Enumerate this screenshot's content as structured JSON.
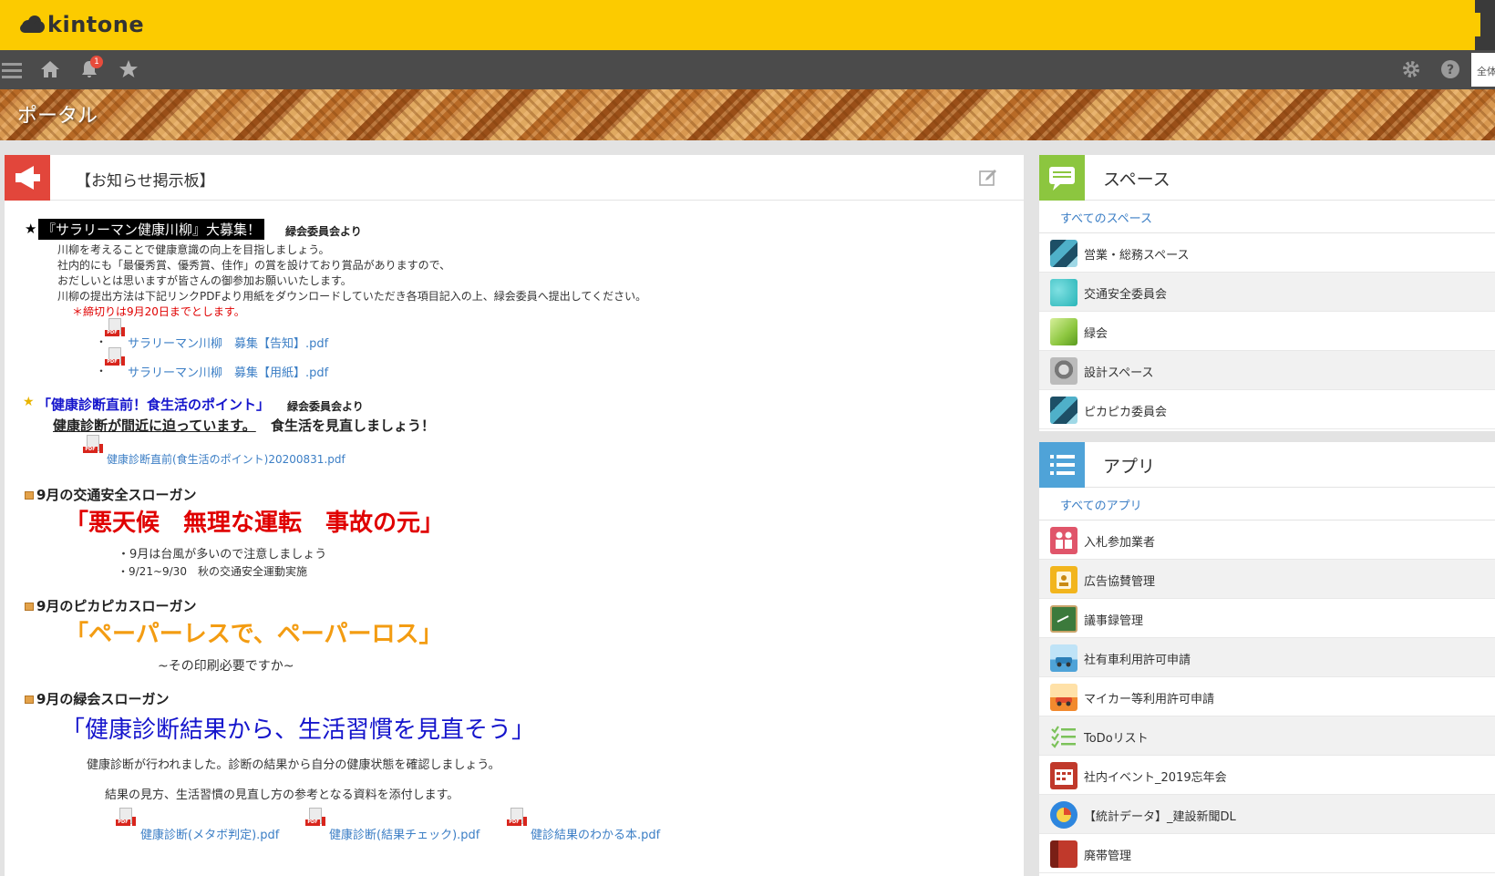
{
  "app": {
    "logo_text": "kintone"
  },
  "navbar": {
    "notification_count": "1",
    "search_placeholder": "全体"
  },
  "banner": {
    "title": "ポータル"
  },
  "notice": {
    "title": "【お知らせ掲示板】",
    "p1": {
      "star": "★",
      "headline": "『サラリーマン健康川柳』大募集！",
      "from": "緑会委員会より",
      "lines": [
        "川柳を考えることで健康意識の向上を目指しましょう。",
        "社内的にも「最優秀賞、優秀賞、佳作」の賞を設けており賞品がありますので、",
        "おだしいとは思いますが皆さんの御参加お願いいたします。",
        "川柳の提出方法は下記リンクPDFより用紙をダウンロードしていただき各項目記入の上、緑会委員へ提出してください。"
      ],
      "deadline": "＊締切りは9月20日までとします。",
      "files": [
        "サラリーマン川柳　募集【告知】.pdf",
        "サラリーマン川柳　募集【用紙】.pdf"
      ]
    },
    "p2": {
      "headline": "「健康診断直前！食生活のポイント」",
      "from": "緑会委員会より",
      "sub_u": "健康診断が間近に迫っています。",
      "sub_rest": "食生活を見直しましょう！",
      "file": "健康診断直前(食生活のポイント)20200831.pdf"
    },
    "p3": {
      "heading": "9月の交通安全スローガン",
      "slogan": "「悪天候　無理な運転　事故の元」",
      "bullets": [
        "・9月は台風が多いので注意しましょう",
        "・9/21~9/30　秋の交通安全運動実施"
      ]
    },
    "p4": {
      "heading": "9月のピカピカスローガン",
      "slogan": "「ペーパーレスで、ペーパーロス」",
      "sub": "~その印刷必要ですか~"
    },
    "p5": {
      "heading": "9月の緑会スローガン",
      "slogan": "「健康診断結果から、生活習慣を見直そう」",
      "line1": "健康診断が行われました。診断の結果から自分の健康状態を確認しましょう。",
      "line2": "結果の見方、生活習慣の見直し方の参考となる資料を添付します。",
      "files": [
        "健康診断(メタボ判定).pdf",
        "健康診断(結果チェック).pdf",
        "健診結果のわかる本.pdf"
      ]
    }
  },
  "spaces": {
    "title": "スペース",
    "all_link": "すべてのスペース",
    "items": [
      {
        "label": "営業・総務スペース",
        "color": "#2b6f8a"
      },
      {
        "label": "交通安全委員会",
        "color": "#29b5b8"
      },
      {
        "label": "緑会",
        "color": "#8cc63f"
      },
      {
        "label": "設計スペース",
        "color": "#8a8a8a"
      },
      {
        "label": "ピカピカ委員会",
        "color": "#2b6f8a"
      }
    ]
  },
  "apps": {
    "title": "アプリ",
    "all_link": "すべてのアプリ",
    "items": [
      {
        "label": "入札参加業者",
        "color": "#e0556a"
      },
      {
        "label": "広告協賛管理",
        "color": "#f2b51d"
      },
      {
        "label": "議事録管理",
        "color": "#3c7a3c"
      },
      {
        "label": "社有車利用許可申請",
        "color": "#4fa3d8"
      },
      {
        "label": "マイカー等利用許可申請",
        "color": "#f28a2e"
      },
      {
        "label": "ToDoリスト",
        "color": "#7cc25a"
      },
      {
        "label": "社内イベント_2019忘年会",
        "color": "#c0392b"
      },
      {
        "label": "【統計データ】_建設新聞DL",
        "color": "#2e86de"
      },
      {
        "label": "廃帯管理",
        "color": "#c0392b"
      }
    ]
  },
  "colors": {
    "topbar": "#fccb00",
    "navbar": "#4b4b4b",
    "link": "#3b7ec5",
    "red_slogan": "#e00000",
    "orange_slogan": "#f39c12",
    "blue_slogan": "#1515cc"
  }
}
